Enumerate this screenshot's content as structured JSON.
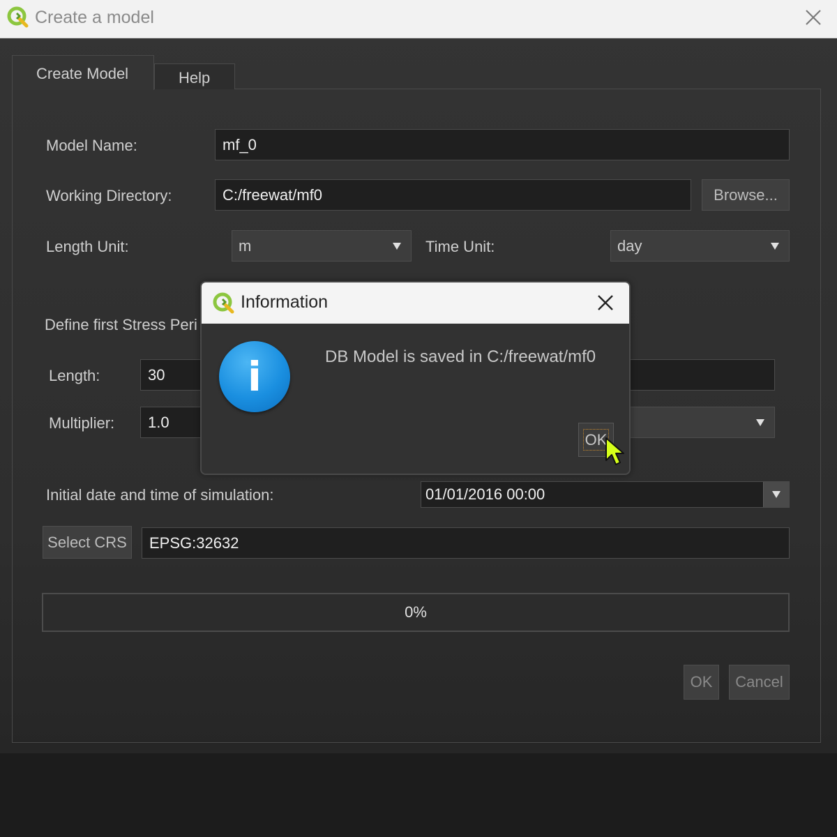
{
  "window": {
    "title": "Create a model"
  },
  "tabs": [
    {
      "label": "Create Model"
    },
    {
      "label": "Help"
    }
  ],
  "form": {
    "model_name_label": "Model Name:",
    "model_name_value": "mf_0",
    "working_dir_label": "Working Directory:",
    "working_dir_value": "C:/freewat/mf0",
    "browse_label": "Browse...",
    "length_unit_label": "Length Unit:",
    "length_unit_value": "m",
    "time_unit_label": "Time Unit:",
    "time_unit_value": "day",
    "stress_period_heading": "Define first Stress Peri",
    "length_label": "Length:",
    "length_value": "30",
    "multiplier_label": "Multiplier:",
    "multiplier_value": "1.0",
    "initial_date_label": "Initial date and time of simulation:",
    "initial_date_value": "01/01/2016 00:00",
    "select_crs_label": "Select CRS",
    "crs_value": "EPSG:32632",
    "progress_text": "0%",
    "progress": 0,
    "ok_label": "OK",
    "cancel_label": "Cancel"
  },
  "dialog": {
    "title": "Information",
    "message": "DB Model is saved in C:/freewat/mf0",
    "ok_label": "OK",
    "icon": "info-icon"
  },
  "colors": {
    "info_blue": "#1a8fe0",
    "qgis_green": "#6bbf3b",
    "cursor_yellow": "#d6ff1a"
  }
}
